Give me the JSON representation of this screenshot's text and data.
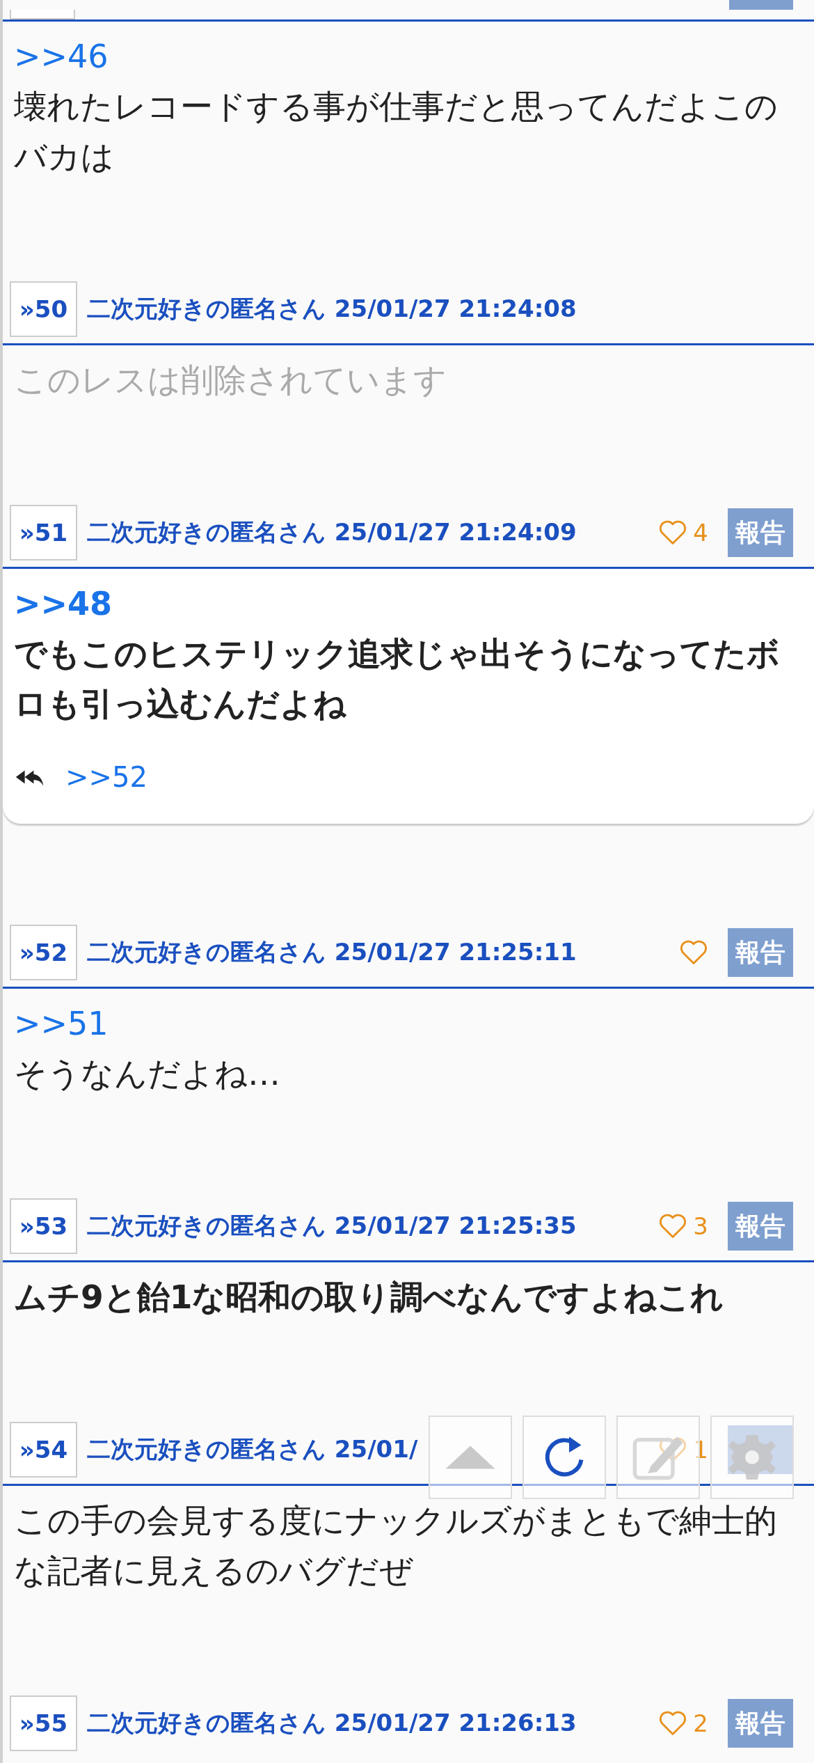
{
  "posts": [
    {
      "body": {
        "anchor": ">>46",
        "text": "壊れたレコードする事が仕事だと思ってんだよこのバカは",
        "bold": false,
        "deleted": false
      }
    },
    {
      "header": {
        "number": "»50",
        "name": "二次元好きの匿名さん",
        "date": "25/01/27 21:24:08",
        "heart": false,
        "report": false
      },
      "body": {
        "text": "このレスは削除されています",
        "bold": false,
        "deleted": true
      }
    },
    {
      "header": {
        "number": "»51",
        "name": "二次元好きの匿名さん",
        "date": "25/01/27 21:24:09",
        "heart": true,
        "likes": "4",
        "report": true,
        "report_label": "報告"
      },
      "body": {
        "anchor": ">>48",
        "text": "でもこのヒステリック追求じゃ出そうになってたボロも引っ込むんだよね",
        "bold": true,
        "deleted": false
      },
      "replies": [
        ">>52"
      ]
    },
    {
      "header": {
        "number": "»52",
        "name": "二次元好きの匿名さん",
        "date": "25/01/27 21:25:11",
        "heart": true,
        "report": true,
        "report_label": "報告"
      },
      "body": {
        "anchor": ">>51",
        "text": "そうなんだよね…",
        "bold": false,
        "deleted": false
      }
    },
    {
      "header": {
        "number": "»53",
        "name": "二次元好きの匿名さん",
        "date": "25/01/27 21:25:35",
        "heart": true,
        "likes": "3",
        "report": true,
        "report_label": "報告"
      },
      "body": {
        "text": "ムチ9と飴1な昭和の取り調べなんですよねこれ",
        "bold": true,
        "deleted": false
      }
    },
    {
      "header": {
        "number": "»54",
        "name": "二次元好きの匿名さん",
        "date": "25/01/",
        "heart": true,
        "likes": "1",
        "report": true
      },
      "body": {
        "text": "この手の会見する度にナックルズがまともで紳士的な記者に見えるのバグだぜ",
        "bold": false,
        "deleted": false
      }
    },
    {
      "header": {
        "number": "»55",
        "name": "二次元好きの匿名さん",
        "date": "25/01/27 21:26:13",
        "heart": true,
        "likes": "2",
        "report": true,
        "report_label": "報告"
      }
    }
  ]
}
